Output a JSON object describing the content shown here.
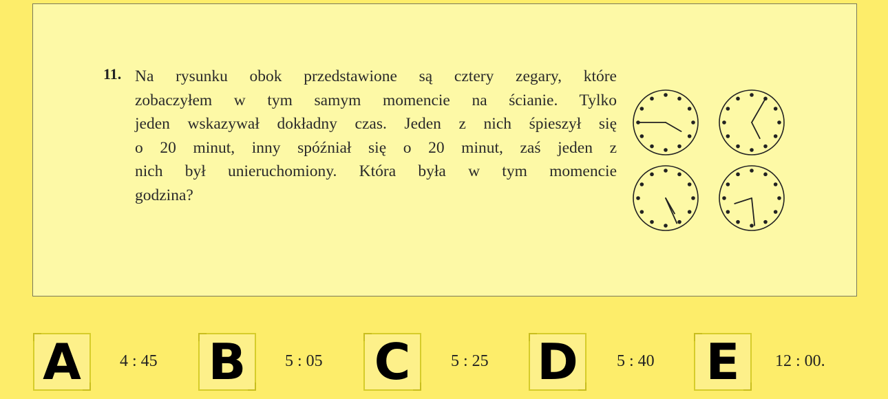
{
  "question": {
    "number": "11.",
    "lines": [
      "Na rysunku obok przedstawione są cztery zegary, które",
      "zobaczyłem w tym samym momencie na ścianie. Tylko",
      "jeden wskazywał dokładny czas. Jeden z nich śpieszył się",
      "o 20 minut, inny spóźniał się o 20 minut, zaś jeden z",
      "nich był unieruchomiony. Która była w tym momencie",
      "godzina?"
    ]
  },
  "clocks": [
    {
      "name": "clock-top-left",
      "hour": 4.0,
      "minute": 45
    },
    {
      "name": "clock-top-right",
      "hour": 5.1,
      "minute": 5
    },
    {
      "name": "clock-bottom-left",
      "hour": 5.0,
      "minute": 26
    },
    {
      "name": "clock-bottom-right",
      "hour": 8.4,
      "minute": 29
    }
  ],
  "answers": [
    {
      "letter": "A",
      "value": "4 : 45"
    },
    {
      "letter": "B",
      "value": "5 : 05"
    },
    {
      "letter": "C",
      "value": "5 : 25"
    },
    {
      "letter": "D",
      "value": "5 : 40"
    },
    {
      "letter": "E",
      "value": "12 : 00."
    }
  ]
}
